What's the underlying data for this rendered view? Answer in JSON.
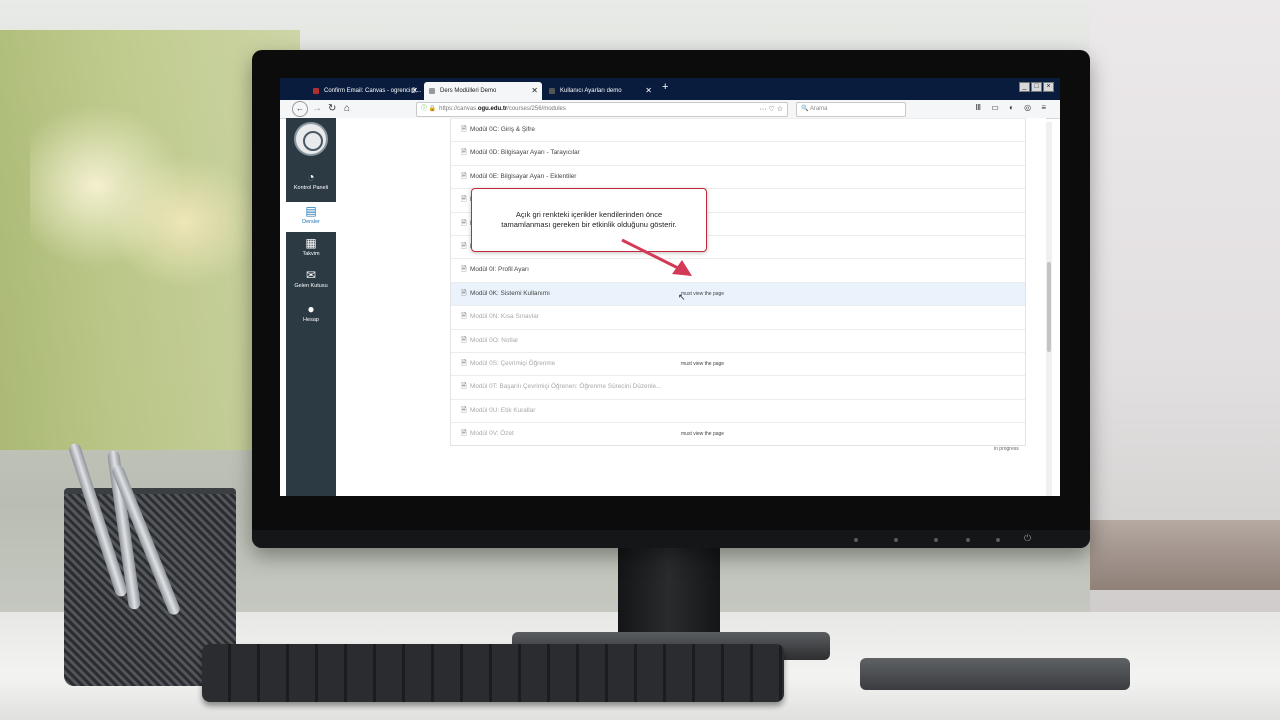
{
  "browser": {
    "tabs": [
      {
        "label": "Confirm Email: Canvas - ogrenci@...",
        "close": "✕",
        "active": false,
        "color": "#b03030"
      },
      {
        "label": "Ders Modülleri Demo",
        "close": "✕",
        "active": true,
        "color": "#999999"
      },
      {
        "label": "Kullanıcı Ayarları demo",
        "close": "✕",
        "active": false,
        "color": "#555555"
      }
    ],
    "new_tab": "+",
    "url_prefix": "https://canvas.",
    "url_domain": "ogu.edu.tr",
    "url_path": "/courses/256/modules",
    "url_icons": "··· ♡ ☆",
    "search_placeholder": "Arama",
    "right_icons": "Ⅲ ▭ ◐ ◎ ≡"
  },
  "global_nav": {
    "items": [
      {
        "label": "Kontrol Paneli",
        "icon": "dashboard-icon",
        "glyph": "◔",
        "active": false
      },
      {
        "label": "Dersler",
        "icon": "courses-icon",
        "glyph": "▤",
        "active": true
      },
      {
        "label": "Takvim",
        "icon": "calendar-icon",
        "glyph": "▦",
        "active": false
      },
      {
        "label": "Gelen Kutusu",
        "icon": "inbox-icon",
        "glyph": "✉",
        "active": false
      },
      {
        "label": "Hesap",
        "icon": "account-icon",
        "glyph": "●",
        "active": false
      }
    ]
  },
  "modules": [
    {
      "title": "Modül 0C: Giriş & Şifre",
      "requirement": "",
      "locked": false
    },
    {
      "title": "Modül 0D: Bilgisayar Ayarı - Tarayıcılar",
      "requirement": "",
      "locked": false
    },
    {
      "title": "Modül 0E: Bilgisayar Ayarı - Eklentiler",
      "requirement": "",
      "locked": false
    },
    {
      "title": "M",
      "requirement": "",
      "locked": false
    },
    {
      "title": "M",
      "requirement": "",
      "locked": false
    },
    {
      "title": "M",
      "requirement": "",
      "locked": false
    },
    {
      "title": "Modül 0I: Profil Ayarı",
      "requirement": "",
      "locked": false
    },
    {
      "title": "Modül 0K: Sistemi Kullanımı",
      "requirement": "must view the page",
      "locked": false,
      "highlight": true
    },
    {
      "title": "Modül 0N: Kısa Sınavlar",
      "requirement": "",
      "locked": true
    },
    {
      "title": "Modül 0O: Notlar",
      "requirement": "",
      "locked": true
    },
    {
      "title": "Modül 0S: Çevrimiçi Öğrenme",
      "requirement": "must view the page",
      "locked": true
    },
    {
      "title": "Modül 0T: Başarılı Çevrimiçi Öğrenen: Öğrenme Sürecini Düzenle...",
      "requirement": "",
      "locked": true
    },
    {
      "title": "Modül 0U: Etik Kurallar",
      "requirement": "",
      "locked": true
    },
    {
      "title": "Modül 0V: Özet",
      "requirement": "must view the page",
      "locked": true
    }
  ],
  "status_text": "in progress",
  "tooltip": {
    "line1": "Açık gri renkteki içerikler kendilerinden önce",
    "line2": "tamamlanması gereken bir etkinlik olduğunu gösterir."
  },
  "colors": {
    "tooltip_border": "#c42a3d",
    "arrow": "#d33a55",
    "nav_bg": "#2c3a44",
    "tab_bar": "#0a1c3d"
  }
}
